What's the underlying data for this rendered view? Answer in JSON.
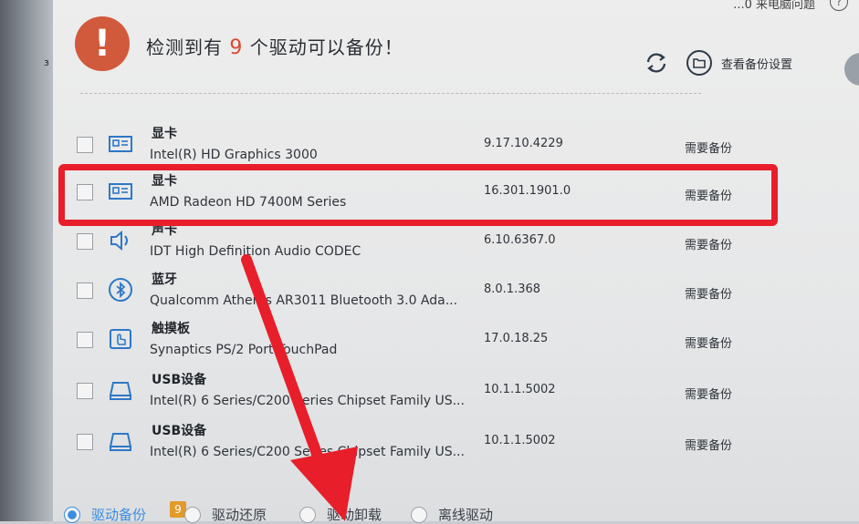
{
  "header": {
    "headline_prefix": "检测到有",
    "headline_count": "9",
    "headline_suffix": "个驱动可以备份！",
    "backup_settings_label": "查看备份设置",
    "top_right_text": "...0 来电脑问题",
    "alert_icon": "exclamation-icon",
    "refresh_icon": "refresh-icon",
    "settings_icon": "folder-icon"
  },
  "drivers": [
    {
      "category": "显卡",
      "name": "Intel(R) HD Graphics 3000",
      "version": "9.17.10.4229",
      "status": "需要备份",
      "icon": "display-card-icon"
    },
    {
      "category": "显卡",
      "name": "AMD Radeon HD 7400M Series",
      "version": "16.301.1901.0",
      "status": "需要备份",
      "icon": "display-card-icon"
    },
    {
      "category": "声卡",
      "name": "IDT High Definition Audio CODEC",
      "version": "6.10.6367.0",
      "status": "需要备份",
      "icon": "speaker-icon"
    },
    {
      "category": "蓝牙",
      "name": "Qualcomm Atheros AR3011 Bluetooth 3.0 Ada...",
      "version": "8.0.1.368",
      "status": "需要备份",
      "icon": "bluetooth-icon"
    },
    {
      "category": "触摸板",
      "name": "Synaptics PS/2 Port TouchPad",
      "version": "17.0.18.25",
      "status": "需要备份",
      "icon": "touchpad-icon"
    },
    {
      "category": "USB设备",
      "name": "Intel(R) 6 Series/C200 Series Chipset Family US...",
      "version": "10.1.1.5002",
      "status": "需要备份",
      "icon": "usb-drive-icon"
    },
    {
      "category": "USB设备",
      "name": "Intel(R) 6 Series/C200 Series Chipset Family US...",
      "version": "10.1.1.5002",
      "status": "需要备份",
      "icon": "usb-drive-icon"
    }
  ],
  "bottom_tabs": [
    {
      "label": "驱动备份",
      "badge": "9",
      "active": true
    },
    {
      "label": "驱动还原",
      "active": false
    },
    {
      "label": "驱动卸载",
      "active": false
    },
    {
      "label": "离线驱动",
      "active": false
    }
  ],
  "colors": {
    "highlight": "#e81e2a",
    "accent": "#3b8de0",
    "alert": "#d25a3c",
    "count": "#d94a2e",
    "badge": "#e29a2a"
  }
}
